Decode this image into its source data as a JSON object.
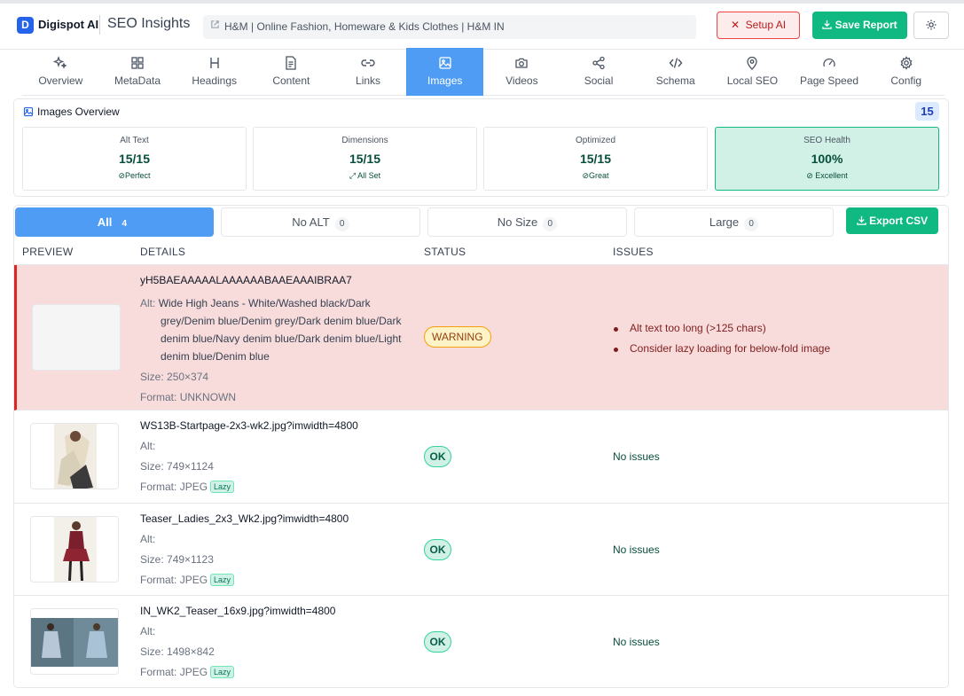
{
  "header": {
    "logo_letter": "D",
    "brand": "Digispot AI",
    "title": "SEO Insights",
    "url_text": "H&M | Online Fashion, Homeware & Kids Clothes | H&M IN",
    "setup_label": "Setup AI",
    "save_label": "Save Report"
  },
  "tabs": [
    {
      "label": "Overview",
      "icon": "sparkles-icon"
    },
    {
      "label": "MetaData",
      "icon": "grid-icon"
    },
    {
      "label": "Headings",
      "icon": "heading-icon"
    },
    {
      "label": "Content",
      "icon": "document-icon"
    },
    {
      "label": "Links",
      "icon": "link-icon"
    },
    {
      "label": "Images",
      "icon": "image-icon",
      "active": true
    },
    {
      "label": "Videos",
      "icon": "camera-icon"
    },
    {
      "label": "Social",
      "icon": "share-icon"
    },
    {
      "label": "Schema",
      "icon": "code-icon"
    },
    {
      "label": "Local SEO",
      "icon": "map-pin-icon"
    },
    {
      "label": "Page Speed",
      "icon": "gauge-icon"
    },
    {
      "label": "Config",
      "icon": "gear-icon"
    }
  ],
  "overview": {
    "title": "Images Overview",
    "count": "15",
    "stats": [
      {
        "title": "Alt Text",
        "value": "15/15",
        "sub": "Perfect"
      },
      {
        "title": "Dimensions",
        "value": "15/15",
        "sub": "All Set"
      },
      {
        "title": "Optimized",
        "value": "15/15",
        "sub": "Great"
      },
      {
        "title": "SEO Health",
        "value": "100%",
        "sub": "Excellent"
      }
    ]
  },
  "filters": [
    {
      "label": "All",
      "count": "4"
    },
    {
      "label": "No ALT",
      "count": "0"
    },
    {
      "label": "No Size",
      "count": "0"
    },
    {
      "label": "Large",
      "count": "0"
    }
  ],
  "export_label": "Export CSV",
  "columns": {
    "preview": "PREVIEW",
    "details": "DETAILS",
    "status": "STATUS",
    "issues": "ISSUES"
  },
  "labels": {
    "alt": "Alt:",
    "size": "Size:",
    "format": "Format:",
    "lazy": "Lazy",
    "no_issues": "No issues"
  },
  "images": [
    {
      "name": "yH5BAEAAAAALAAAAAABAAEAAAIBRAA7",
      "alt": "Wide High Jeans - White/Washed black/Dark grey/Denim blue/Denim grey/Dark denim blue/Dark denim blue/Navy denim blue/Dark denim blue/Light denim blue/Denim blue",
      "size": "250×374",
      "format": "UNKNOWN",
      "status": "WARNING",
      "issues": [
        "Alt text too long (>125 chars)",
        "Consider lazy loading for below-fold image"
      ]
    },
    {
      "name": "WS13B-Startpage-2x3-wk2.jpg?imwidth=4800",
      "alt": "",
      "size": "749×1124",
      "format": "JPEG",
      "status": "OK"
    },
    {
      "name": "Teaser_Ladies_2x3_Wk2.jpg?imwidth=4800",
      "alt": "",
      "size": "749×1123",
      "format": "JPEG",
      "status": "OK"
    },
    {
      "name": "IN_WK2_Teaser_16x9.jpg?imwidth=4800",
      "alt": "",
      "size": "1498×842",
      "format": "JPEG",
      "status": "OK"
    }
  ]
}
